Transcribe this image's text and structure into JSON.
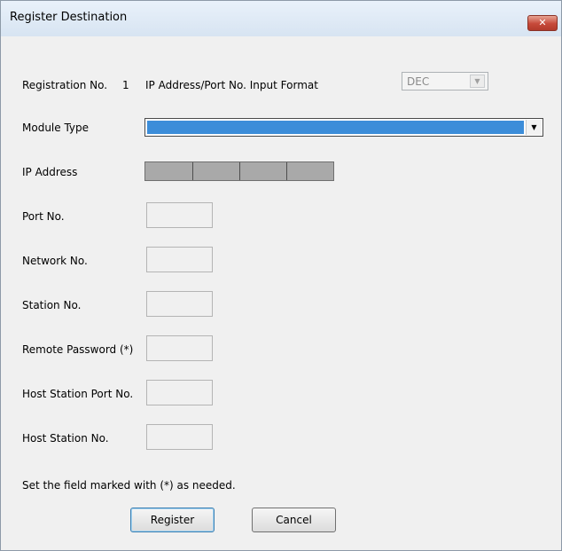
{
  "window": {
    "title": "Register Destination",
    "close_glyph": "✕"
  },
  "registration": {
    "label": "Registration No.",
    "number": "1"
  },
  "input_format": {
    "label": "IP Address/Port No. Input Format",
    "value": "DEC",
    "arrow": "▼",
    "enabled": false
  },
  "module_type": {
    "label": "Module Type",
    "value": "",
    "arrow": "▼"
  },
  "ip_address": {
    "label": "IP Address",
    "octets": [
      "",
      "",
      "",
      ""
    ]
  },
  "fields": {
    "port_no": {
      "label": "Port No.",
      "value": ""
    },
    "network_no": {
      "label": "Network No.",
      "value": ""
    },
    "station_no": {
      "label": "Station No.",
      "value": ""
    },
    "remote_password": {
      "label": "Remote Password (*)",
      "value": ""
    },
    "host_station_port_no": {
      "label": "Host Station Port No.",
      "value": ""
    },
    "host_station_no": {
      "label": "Host Station No.",
      "value": ""
    }
  },
  "note": "Set the field marked with (*) as needed.",
  "buttons": {
    "register": "Register",
    "cancel": "Cancel"
  },
  "colors": {
    "selection": "#3c8dd9",
    "ip_field": "#a9a9a9",
    "close": "#c6493a"
  }
}
